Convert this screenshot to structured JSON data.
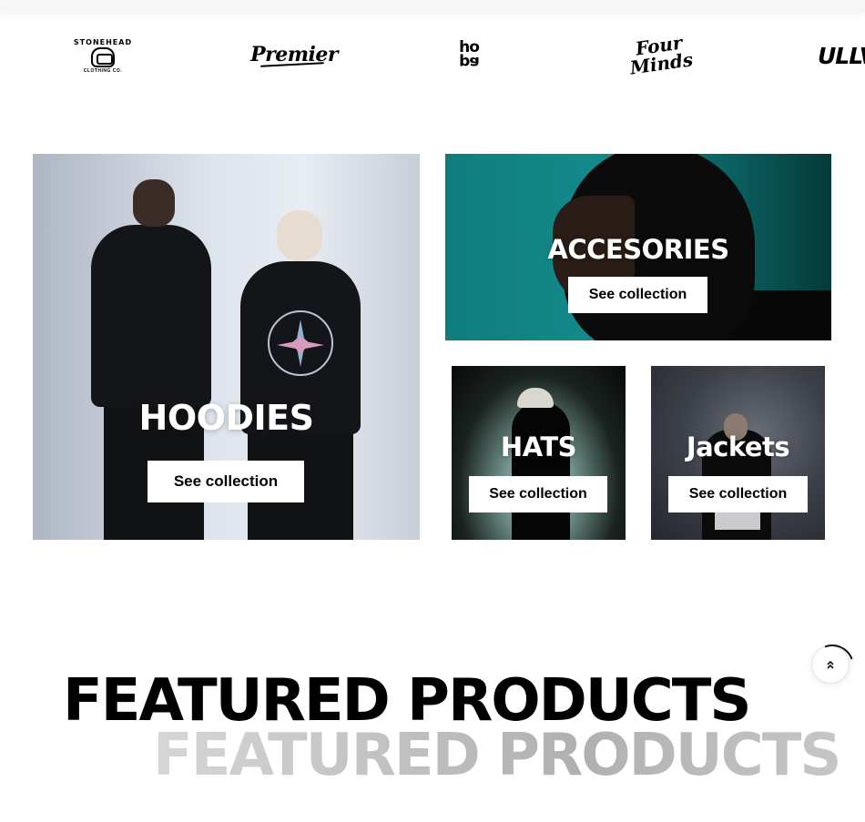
{
  "brands": {
    "stonehead": {
      "ring": "STONEHEAD",
      "sub": "CLOTHING CO."
    },
    "premier": {
      "label": "Premier"
    },
    "hopa": {
      "line1": "ho",
      "line2": "pa"
    },
    "fourminds": {
      "line1": "Four",
      "line2": "Minds"
    },
    "ully": {
      "label": "ULLV"
    }
  },
  "collections": [
    {
      "title": "HOODIES",
      "button": "See collection"
    },
    {
      "title": "ACCESORIES",
      "button": "See collection"
    },
    {
      "title": "HATS",
      "button": "See collection"
    },
    {
      "title": "Jackets",
      "button": "See collection"
    }
  ],
  "featured": {
    "heading": "FEATURED PRODUCTS",
    "heading_ghost": "FEATURED PRODUCTS"
  },
  "scroll_top": {
    "icon": "double-chevron-up-icon"
  },
  "colors": {
    "accent_teal": "#138a8a",
    "button_bg": "#ffffff",
    "ghost_text": "#c8c8c8"
  }
}
